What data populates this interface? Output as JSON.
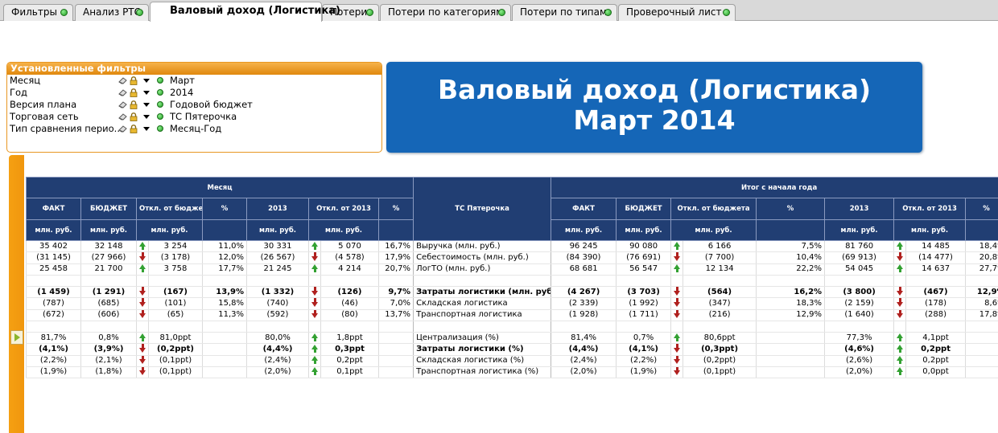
{
  "tabs": [
    "Фильтры",
    "Анализ РТО",
    "Валовый доход (Логистика)",
    "Потери",
    "Потери по категориям",
    "Потери по типам",
    "Проверочный лист"
  ],
  "filters": {
    "title": "Установленные фильтры",
    "rows": [
      {
        "label": "Месяц",
        "value": "Март"
      },
      {
        "label": "Год",
        "value": "2014"
      },
      {
        "label": "Версия плана",
        "value": "Годовой бюджет"
      },
      {
        "label": "Торговая сеть",
        "value": "ТС Пятерочка"
      },
      {
        "label": "Тип сравнения перио...",
        "value": "Месяц-Год"
      }
    ]
  },
  "banner": {
    "line1": "Валовый доход (Логистика)",
    "line2": "Март 2014"
  },
  "table": {
    "group_left": "Месяц",
    "group_right": "Итог с начала года",
    "center_header": "ТС Пятерочка",
    "sub_headers": [
      "ФАКТ",
      "БЮДЖЕТ",
      "Откл. от бюджета",
      "2013",
      "Откл. от 2013"
    ],
    "pct_header": "%",
    "unit": "млн. руб.",
    "rows": [
      {
        "bold": false,
        "label": "Выручка (млн. руб.)",
        "m": [
          "35 402",
          "32 148",
          "up",
          "3 254",
          "11,0%",
          "30 331",
          "up",
          "5 070",
          "16,7%"
        ],
        "y": [
          "96 245",
          "90 080",
          "up",
          "6 166",
          "7,5%",
          "81 760",
          "up",
          "14 485",
          "18,4%"
        ]
      },
      {
        "bold": false,
        "label": "Себестоимость (млн. руб.)",
        "m": [
          "(31 145)",
          "(27 966)",
          "down",
          "(3 178)",
          "12,0%",
          "(26 567)",
          "down",
          "(4 578)",
          "17,9%"
        ],
        "y": [
          "(84 390)",
          "(76 691)",
          "down",
          "(7 700)",
          "10,4%",
          "(69 913)",
          "down",
          "(14 477)",
          "20,8%"
        ]
      },
      {
        "bold": false,
        "label": "ЛогТО (млн. руб.)",
        "m": [
          "25 458",
          "21 700",
          "up",
          "3 758",
          "17,7%",
          "21 245",
          "up",
          "4 214",
          "20,7%"
        ],
        "y": [
          "68 681",
          "56 547",
          "up",
          "12 134",
          "22,2%",
          "54 045",
          "up",
          "14 637",
          "27,7%"
        ]
      },
      {
        "spacer": true
      },
      {
        "bold": true,
        "label": "Затраты логистики (млн. руб.)",
        "m": [
          "(1 459)",
          "(1 291)",
          "down",
          "(167)",
          "13,9%",
          "(1 332)",
          "down",
          "(126)",
          "9,7%"
        ],
        "y": [
          "(4 267)",
          "(3 703)",
          "down",
          "(564)",
          "16,2%",
          "(3 800)",
          "down",
          "(467)",
          "12,9%"
        ]
      },
      {
        "bold": false,
        "label": "Складская логистика",
        "m": [
          "(787)",
          "(685)",
          "down",
          "(101)",
          "15,8%",
          "(740)",
          "down",
          "(46)",
          "7,0%"
        ],
        "y": [
          "(2 339)",
          "(1 992)",
          "down",
          "(347)",
          "18,3%",
          "(2 159)",
          "down",
          "(178)",
          "8,6%"
        ]
      },
      {
        "bold": false,
        "label": "Транспортная логистика",
        "m": [
          "(672)",
          "(606)",
          "down",
          "(65)",
          "11,3%",
          "(592)",
          "down",
          "(80)",
          "13,7%"
        ],
        "y": [
          "(1 928)",
          "(1 711)",
          "down",
          "(216)",
          "12,9%",
          "(1 640)",
          "down",
          "(288)",
          "17,8%"
        ]
      },
      {
        "spacer": true
      },
      {
        "bold": false,
        "label": "Централизация (%)",
        "m": [
          "81,7%",
          "0,8%",
          "up",
          "81,0ppt",
          "",
          "80,0%",
          "up",
          "1,8ppt",
          ""
        ],
        "y": [
          "81,4%",
          "0,7%",
          "up",
          "80,6ppt",
          "",
          "77,3%",
          "up",
          "4,1ppt",
          ""
        ]
      },
      {
        "bold": true,
        "label": "Затраты логистики (%)",
        "m": [
          "(4,1%)",
          "(3,9%)",
          "down",
          "(0,2ppt)",
          "",
          "(4,4%)",
          "up",
          "0,3ppt",
          ""
        ],
        "y": [
          "(4,4%)",
          "(4,1%)",
          "down",
          "(0,3ppt)",
          "",
          "(4,6%)",
          "up",
          "0,2ppt",
          ""
        ]
      },
      {
        "bold": false,
        "label": "Складская логистика (%)",
        "m": [
          "(2,2%)",
          "(2,1%)",
          "down",
          "(0,1ppt)",
          "",
          "(2,4%)",
          "up",
          "0,2ppt",
          ""
        ],
        "y": [
          "(2,4%)",
          "(2,2%)",
          "down",
          "(0,2ppt)",
          "",
          "(2,6%)",
          "up",
          "0,2ppt",
          ""
        ]
      },
      {
        "bold": false,
        "label": "Транспортная логистика (%)",
        "m": [
          "(1,9%)",
          "(1,8%)",
          "down",
          "(0,1ppt)",
          "",
          "(2,0%)",
          "up",
          "0,1ppt",
          ""
        ],
        "y": [
          "(2,0%)",
          "(1,9%)",
          "down",
          "(0,1ppt)",
          "",
          "(2,0%)",
          "up",
          "0,0ppt",
          ""
        ]
      }
    ]
  }
}
